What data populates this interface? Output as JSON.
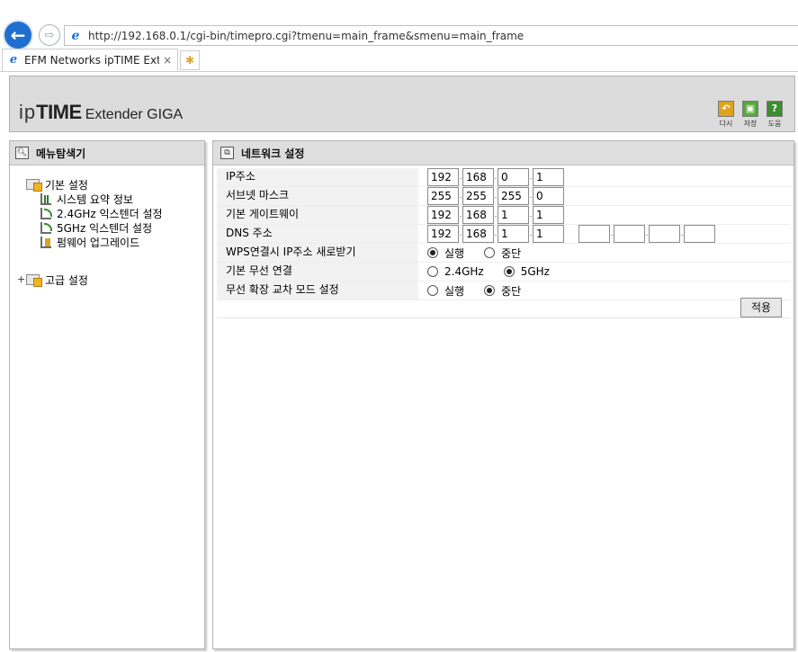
{
  "browser": {
    "url": "http://192.168.0.1/cgi-bin/timepro.cgi?tmenu=main_frame&smenu=main_frame",
    "tab_title": "EFM Networks ipTIME Exte...",
    "tab_close": "×"
  },
  "header": {
    "logo_ip": "ip",
    "logo_time": "TIME",
    "logo_product": "Extender GIGA",
    "tools": [
      {
        "label": "다시",
        "icon": "refresh-icon",
        "color": "#e0a31f"
      },
      {
        "label": "저장",
        "icon": "save-icon",
        "color": "#58a83c"
      },
      {
        "label": "도움",
        "icon": "help-icon",
        "color": "#3c8d2f"
      }
    ]
  },
  "left": {
    "title": "메뉴탐색기",
    "basic": "기본 설정",
    "items": [
      "시스템 요약 정보",
      "2.4GHz 익스텐더 설정",
      "5GHz 익스텐더 설정",
      "펌웨어 업그레이드"
    ],
    "advanced": "고급 설정",
    "expand": "+"
  },
  "right": {
    "title": "네트워크 설정",
    "labels": {
      "ip": "IP주소",
      "subnet": "서브넷 마스크",
      "gateway": "기본 게이트웨이",
      "dns": "DNS 주소",
      "wps": "WPS연결시 IP주소 새로받기",
      "wireless": "기본 무선 연결",
      "mode": "무선 확장 교차 모드 설정"
    },
    "ip": [
      "192",
      "168",
      "0",
      "1"
    ],
    "subnet": [
      "255",
      "255",
      "255",
      "0"
    ],
    "gateway": [
      "192",
      "168",
      "1",
      "1"
    ],
    "dns1": [
      "192",
      "168",
      "1",
      "1"
    ],
    "dns2": [
      "",
      "",
      "",
      ""
    ],
    "wps_options": [
      "실행",
      "중단"
    ],
    "wps_selected": "실행",
    "wireless_options": [
      "2.4GHz",
      "5GHz"
    ],
    "wireless_selected": "5GHz",
    "mode_options": [
      "실행",
      "중단"
    ],
    "mode_selected": "중단",
    "apply": "적용"
  }
}
